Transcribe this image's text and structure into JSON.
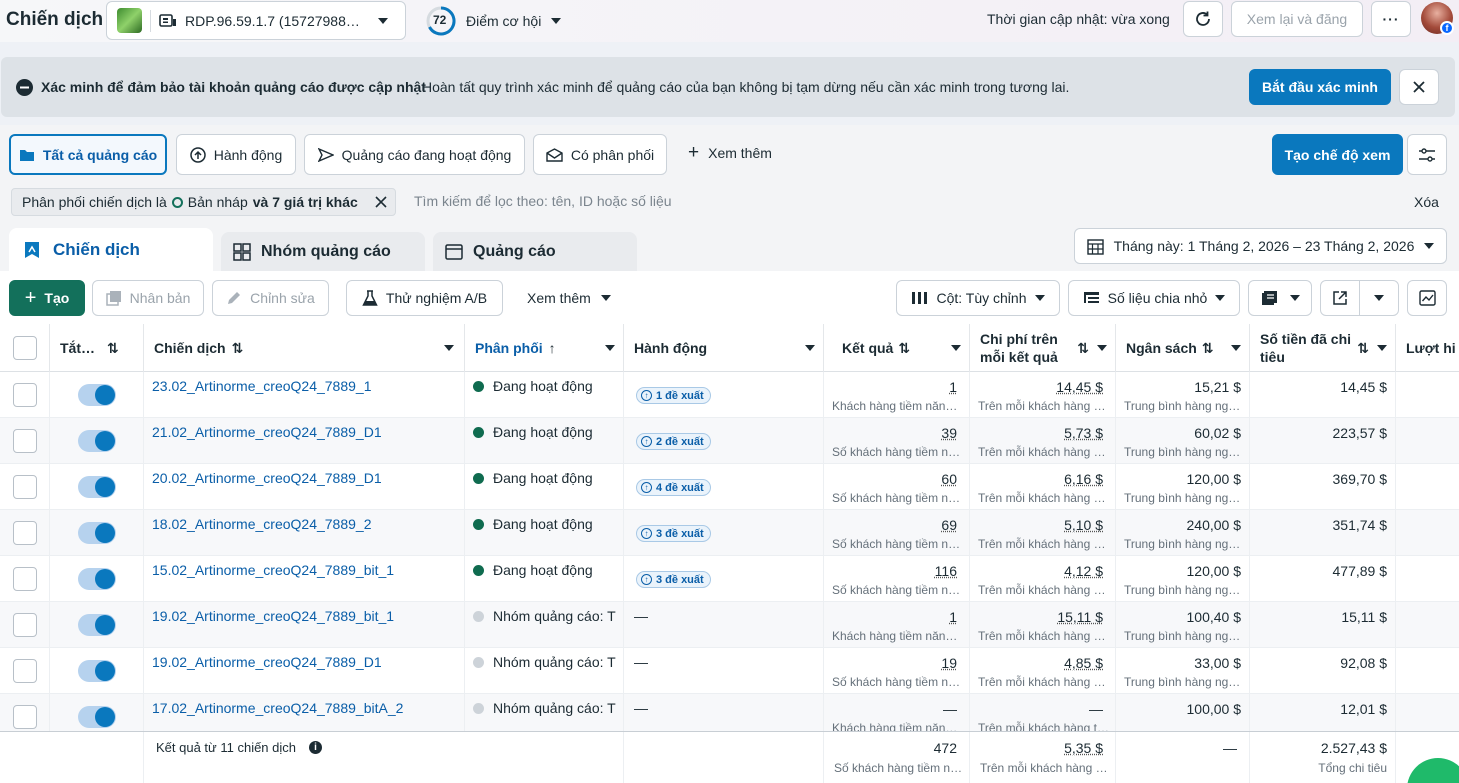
{
  "topbar": {
    "title": "Chiến dịch",
    "account_name": "RDP.96.59.1.7 (15727988…",
    "score": "72",
    "score_label": "Điểm cơ hội",
    "update_time": "Thời gian cập nhật: vừa xong",
    "review_publish": "Xem lại và đăng",
    "more": "···"
  },
  "banner": {
    "title": "Xác minh để đảm bảo tài khoản quảng cáo được cập nhật",
    "text": "Hoàn tất quy trình xác minh để quảng cáo của bạn không bị tạm dừng nếu cần xác minh trong tương lai.",
    "cta": "Bắt đầu xác minh"
  },
  "views": {
    "all_ads": "Tất cả quảng cáo",
    "actions": "Hành động",
    "active_ads": "Quảng cáo đang hoạt động",
    "delivered": "Có phân phối",
    "see_more": "Xem thêm",
    "create_view": "Tạo chế độ xem"
  },
  "filter": {
    "chip_prefix": "Phân phối chiến dịch là",
    "chip_value": "Bản nháp",
    "chip_suffix": "và 7 giá trị khác",
    "placeholder": "Tìm kiếm để lọc theo: tên, ID hoặc số liệu",
    "clear": "Xóa"
  },
  "tabs": {
    "campaigns": "Chiến dịch",
    "adsets": "Nhóm quảng cáo",
    "ads": "Quảng cáo",
    "date_range": "Tháng này: 1 Tháng 2, 2026 – 23 Tháng 2, 2026"
  },
  "toolbar": {
    "create": "Tạo",
    "duplicate": "Nhân bản",
    "edit": "Chỉnh sửa",
    "ab_test": "Thử nghiệm A/B",
    "see_more": "Xem thêm",
    "columns": "Cột: Tùy chỉnh",
    "breakdown": "Số liệu chia nhỏ"
  },
  "table": {
    "headers": {
      "toggle": "Tắt…",
      "campaign": "Chiến dịch",
      "delivery": "Phân phối",
      "actions": "Hành động",
      "results": "Kết quả",
      "cpr_line1": "Chi phí trên",
      "cpr_line2": "mỗi kết quả",
      "budget": "Ngân sách",
      "spent_line1": "Số tiền đã chi",
      "spent_line2": "tiêu",
      "reach": "Lượt hi"
    },
    "rows": [
      {
        "name": "23.02_Artinorme_creoQ24_7889_1",
        "status": "Đang hoạt động",
        "active": true,
        "action": "1 đề xuất",
        "result": "1",
        "result_sub": "Khách hàng tiềm năn…",
        "cpr": "14,45 $",
        "cpr_sub": "Trên mỗi khách hàng …",
        "budget": "15,21 $",
        "budget_sub": "Trung bình hàng ng…",
        "spent": "14,45 $"
      },
      {
        "name": "21.02_Artinorme_creoQ24_7889_D1",
        "status": "Đang hoạt động",
        "active": true,
        "action": "2 đề xuất",
        "result": "39",
        "result_sub": "Số khách hàng tiềm n…",
        "cpr": "5,73 $",
        "cpr_sub": "Trên mỗi khách hàng …",
        "budget": "60,02 $",
        "budget_sub": "Trung bình hàng ng…",
        "spent": "223,57 $"
      },
      {
        "name": "20.02_Artinorme_creoQ24_7889_D1",
        "status": "Đang hoạt động",
        "active": true,
        "action": "4 đề xuất",
        "result": "60",
        "result_sub": "Số khách hàng tiềm n…",
        "cpr": "6,16 $",
        "cpr_sub": "Trên mỗi khách hàng …",
        "budget": "120,00 $",
        "budget_sub": "Trung bình hàng ng…",
        "spent": "369,70 $"
      },
      {
        "name": "18.02_Artinorme_creoQ24_7889_2",
        "status": "Đang hoạt động",
        "active": true,
        "action": "3 đề xuất",
        "result": "69",
        "result_sub": "Số khách hàng tiềm n…",
        "cpr": "5,10 $",
        "cpr_sub": "Trên mỗi khách hàng …",
        "budget": "240,00 $",
        "budget_sub": "Trung bình hàng ng…",
        "spent": "351,74 $"
      },
      {
        "name": "15.02_Artinorme_creoQ24_7889_bit_1",
        "status": "Đang hoạt động",
        "active": true,
        "action": "3 đề xuất",
        "result": "116",
        "result_sub": "Số khách hàng tiềm n…",
        "cpr": "4,12 $",
        "cpr_sub": "Trên mỗi khách hàng …",
        "budget": "120,00 $",
        "budget_sub": "Trung bình hàng ng…",
        "spent": "477,89 $"
      },
      {
        "name": "19.02_Artinorme_creoQ24_7889_bit_1",
        "status": "Nhóm quảng cáo: T",
        "active": false,
        "action": "—",
        "result": "1",
        "result_sub": "Khách hàng tiềm năn…",
        "cpr": "15,11 $",
        "cpr_sub": "Trên mỗi khách hàng …",
        "budget": "100,40 $",
        "budget_sub": "Trung bình hàng ng…",
        "spent": "15,11 $"
      },
      {
        "name": "19.02_Artinorme_creoQ24_7889_D1",
        "status": "Nhóm quảng cáo: T",
        "active": false,
        "action": "—",
        "result": "19",
        "result_sub": "Số khách hàng tiềm n…",
        "cpr": "4,85 $",
        "cpr_sub": "Trên mỗi khách hàng …",
        "budget": "33,00 $",
        "budget_sub": "Trung bình hàng ng…",
        "spent": "92,08 $"
      },
      {
        "name": "17.02_Artinorme_creoQ24_7889_bitA_2",
        "status": "Nhóm quảng cáo: T",
        "active": false,
        "action": "—",
        "result": "—",
        "result_sub": "Khách hàng tiềm năn…",
        "cpr": "—",
        "cpr_sub": "Trên mỗi khách hàng t…",
        "budget": "100,00 $",
        "budget_sub": "",
        "spent": "12,01 $"
      }
    ],
    "summary": {
      "label": "Kết quả từ 11 chiến dịch",
      "result": "472",
      "result_sub": "Số khách hàng tiềm n…",
      "cpr": "5,35 $",
      "cpr_sub": "Trên mỗi khách hàng …",
      "budget": "—",
      "spent": "2.527,43 $",
      "spent_sub": "Tổng chi tiêu"
    }
  },
  "colors": {
    "accent": "#0a78be",
    "create": "#13705b",
    "active_dot": "#0f6b4f",
    "inactive_dot": "#cdd3d9"
  }
}
